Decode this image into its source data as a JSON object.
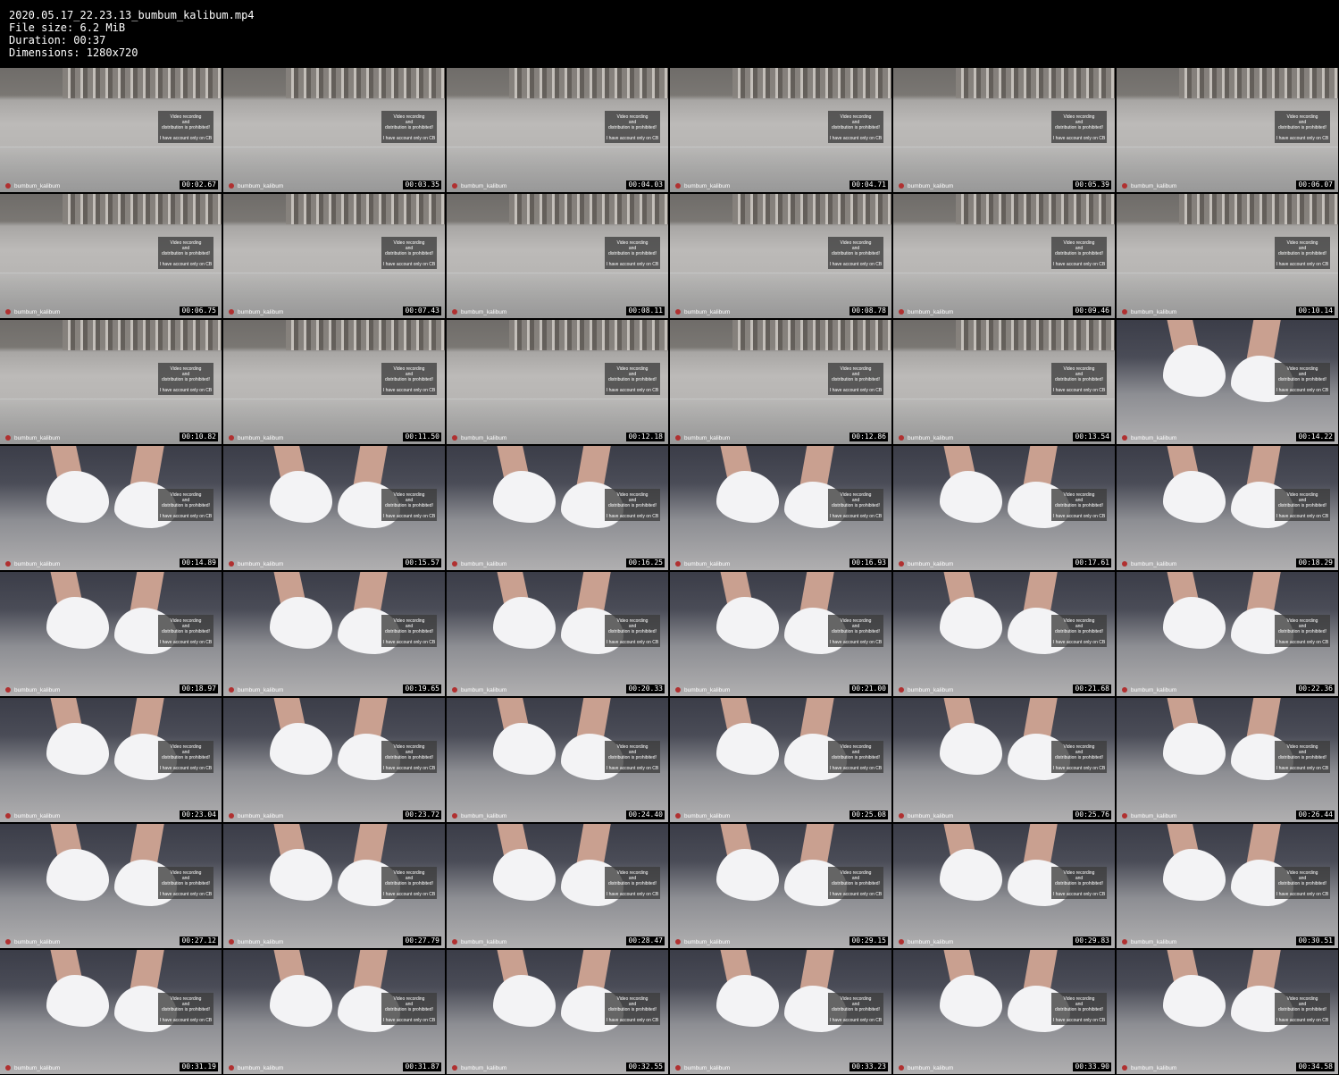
{
  "header": {
    "filename": "2020.05.17_22.23.13_bumbum_kalibum.mp4",
    "filesize": "File size: 6.2 MiB",
    "duration": "Duration: 00:37",
    "dimensions": "Dimensions: 1280x720"
  },
  "overlay": {
    "line1": "Video recording",
    "line2": "and",
    "line3": "distribution is prohibited!",
    "line4": "I have account only on CB",
    "username": "bumbum_kalibum"
  },
  "thumbnails": [
    {
      "time": "00:02.67",
      "scene": "bed"
    },
    {
      "time": "00:03.35",
      "scene": "bed"
    },
    {
      "time": "00:04.03",
      "scene": "bed"
    },
    {
      "time": "00:04.71",
      "scene": "bed"
    },
    {
      "time": "00:05.39",
      "scene": "bed"
    },
    {
      "time": "00:06.07",
      "scene": "bed"
    },
    {
      "time": "00:06.75",
      "scene": "bed"
    },
    {
      "time": "00:07.43",
      "scene": "bed"
    },
    {
      "time": "00:08.11",
      "scene": "bed"
    },
    {
      "time": "00:08.78",
      "scene": "bed"
    },
    {
      "time": "00:09.46",
      "scene": "bed"
    },
    {
      "time": "00:10.14",
      "scene": "bed"
    },
    {
      "time": "00:10.82",
      "scene": "bed"
    },
    {
      "time": "00:11.50",
      "scene": "bed"
    },
    {
      "time": "00:12.18",
      "scene": "bed"
    },
    {
      "time": "00:12.86",
      "scene": "bed"
    },
    {
      "time": "00:13.54",
      "scene": "bed"
    },
    {
      "time": "00:14.22",
      "scene": "feet"
    },
    {
      "time": "00:14.89",
      "scene": "feet"
    },
    {
      "time": "00:15.57",
      "scene": "feet"
    },
    {
      "time": "00:16.25",
      "scene": "feet"
    },
    {
      "time": "00:16.93",
      "scene": "feet"
    },
    {
      "time": "00:17.61",
      "scene": "feet"
    },
    {
      "time": "00:18.29",
      "scene": "feet"
    },
    {
      "time": "00:18.97",
      "scene": "feet"
    },
    {
      "time": "00:19.65",
      "scene": "feet"
    },
    {
      "time": "00:20.33",
      "scene": "feet"
    },
    {
      "time": "00:21.00",
      "scene": "feet"
    },
    {
      "time": "00:21.68",
      "scene": "feet"
    },
    {
      "time": "00:22.36",
      "scene": "feet"
    },
    {
      "time": "00:23.04",
      "scene": "feet"
    },
    {
      "time": "00:23.72",
      "scene": "feet"
    },
    {
      "time": "00:24.40",
      "scene": "feet"
    },
    {
      "time": "00:25.08",
      "scene": "feet"
    },
    {
      "time": "00:25.76",
      "scene": "feet"
    },
    {
      "time": "00:26.44",
      "scene": "feet"
    },
    {
      "time": "00:27.12",
      "scene": "feet"
    },
    {
      "time": "00:27.79",
      "scene": "feet"
    },
    {
      "time": "00:28.47",
      "scene": "feet"
    },
    {
      "time": "00:29.15",
      "scene": "feet"
    },
    {
      "time": "00:29.83",
      "scene": "feet"
    },
    {
      "time": "00:30.51",
      "scene": "feet"
    },
    {
      "time": "00:31.19",
      "scene": "feet"
    },
    {
      "time": "00:31.87",
      "scene": "feet"
    },
    {
      "time": "00:32.55",
      "scene": "feet"
    },
    {
      "time": "00:33.23",
      "scene": "feet"
    },
    {
      "time": "00:33.90",
      "scene": "feet"
    },
    {
      "time": "00:34.58",
      "scene": "feet"
    }
  ]
}
